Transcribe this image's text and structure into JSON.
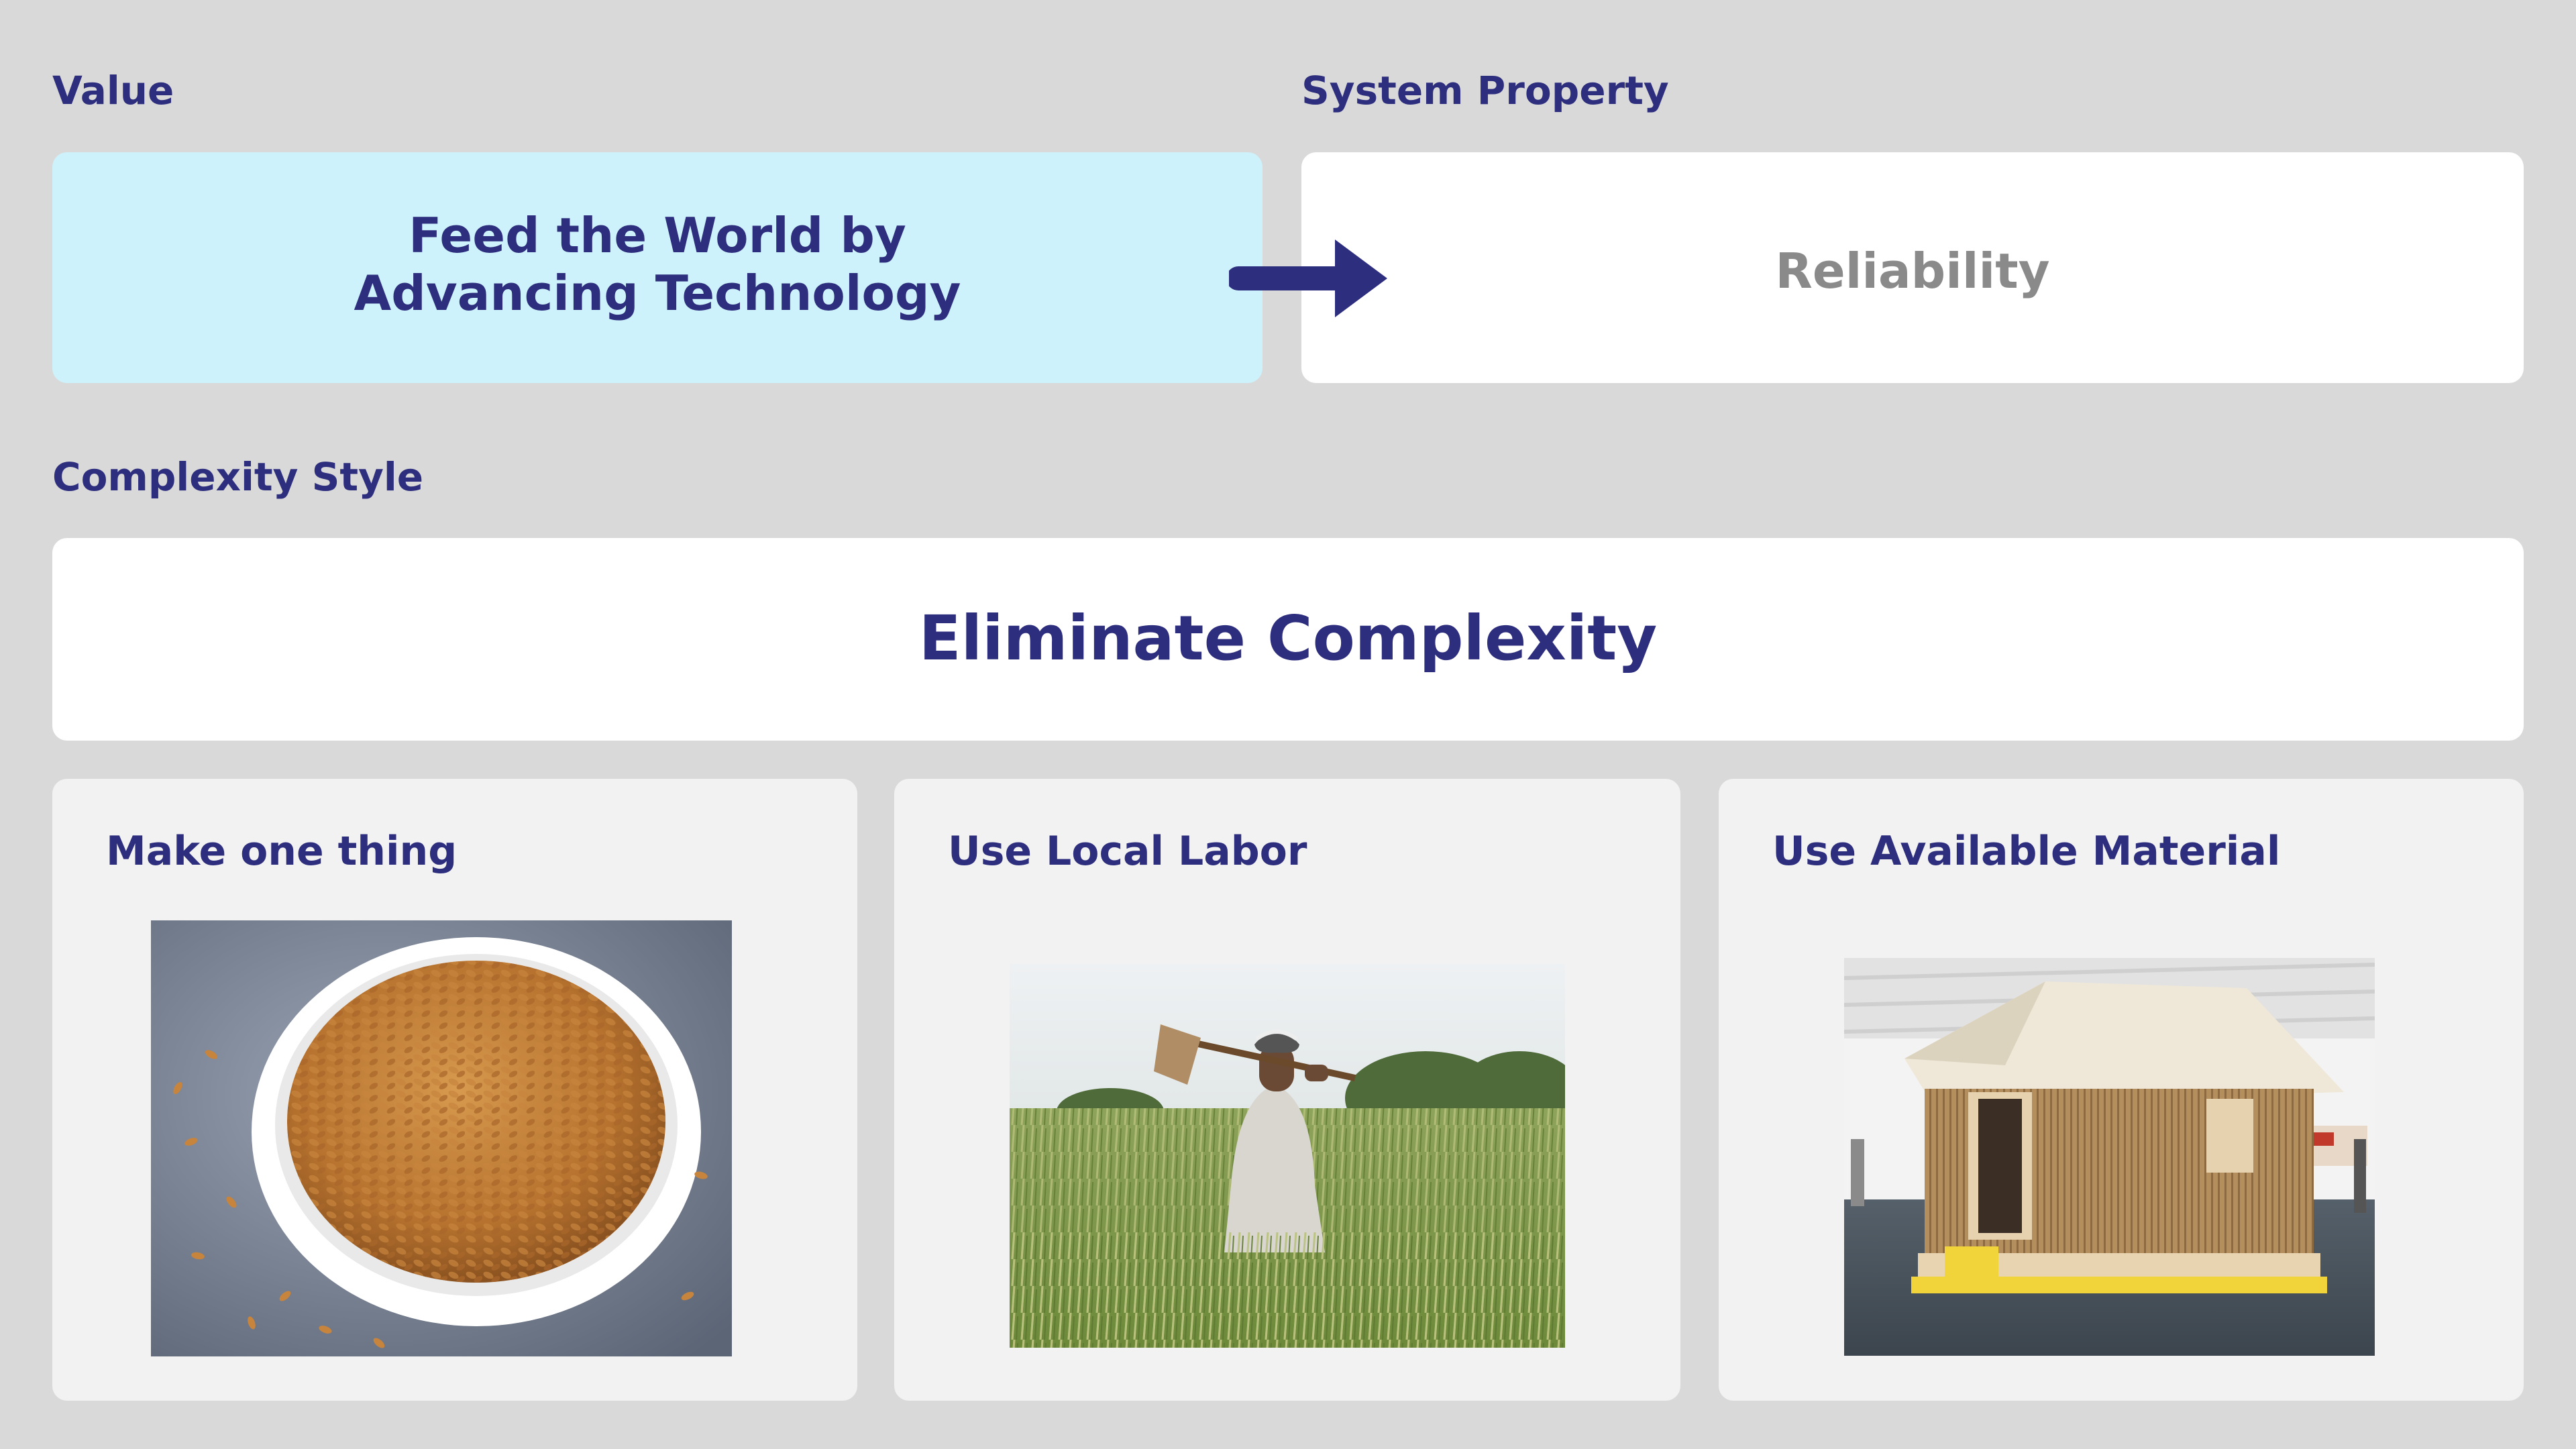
{
  "labels": {
    "value": "Value",
    "system_property": "System Property",
    "complexity_style": "Complexity Style"
  },
  "value_box": {
    "line1": "Feed the World by",
    "line2": "Advancing Technology"
  },
  "system_property_box": {
    "text": "Reliability"
  },
  "complexity_box": {
    "text": "Eliminate Complexity"
  },
  "cards": [
    {
      "title": "Make one thing",
      "image": "bowl-of-wheat-grains-photo"
    },
    {
      "title": "Use Local Labor",
      "image": "farmer-in-wheat-field-photo"
    },
    {
      "title": "Use Available Material",
      "image": "cardboard-tube-house-photo"
    }
  ],
  "colors": {
    "background": "#d9d9d9",
    "accent_navy": "#2e2e7e",
    "value_fill": "#cdf2fb",
    "muted_text": "#8a8a8a",
    "card_fill": "#f2f2f2"
  }
}
